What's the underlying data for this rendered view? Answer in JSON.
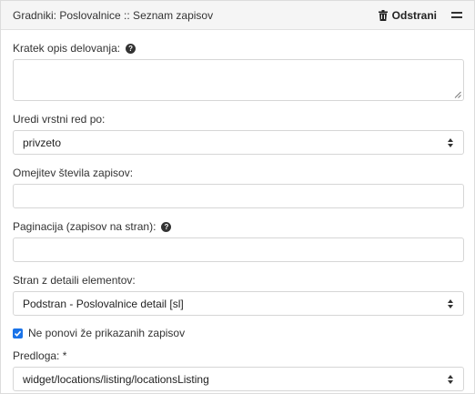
{
  "header": {
    "title": "Gradniki: Poslovalnice :: Seznam zapisov",
    "remove_label": "Odstrani"
  },
  "fields": {
    "description": {
      "label": "Kratek opis delovanja:",
      "value": ""
    },
    "order": {
      "label": "Uredi vrstni red po:",
      "value": "privzeto"
    },
    "limit": {
      "label": "Omejitev števila zapisov:",
      "value": ""
    },
    "pagination": {
      "label": "Paginacija (zapisov na stran):",
      "value": ""
    },
    "detail_page": {
      "label": "Stran z detaili elementov:",
      "value": "Podstran - Poslovalnice detail [sl]"
    },
    "no_repeat": {
      "label": "Ne ponovi že prikazanih zapisov",
      "checked": true
    },
    "template": {
      "label": "Predloga: *",
      "value": "widget/locations/listing/locationsListing"
    }
  },
  "icons": {
    "remove": "trash-icon",
    "drag": "drag-handle-icon",
    "help": "question-circle-icon",
    "select": "sort-icon"
  },
  "colors": {
    "header_bg": "#f5f5f5",
    "checkbox": "#1a73e8",
    "border": "#d6d6d6"
  }
}
